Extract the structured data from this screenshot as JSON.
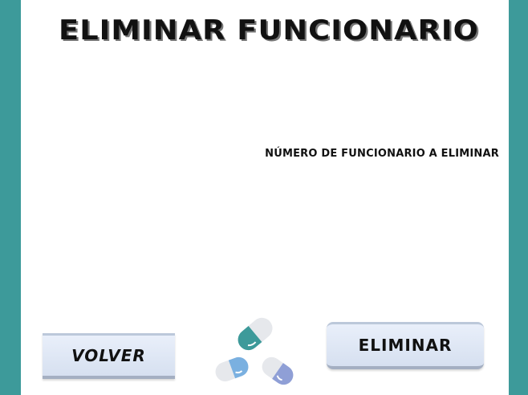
{
  "page": {
    "title": "ELIMINAR FUNCIONARIO",
    "field_label": "NÚMERO DE FUNCIONARIO A ELIMINAR"
  },
  "buttons": {
    "back_label": "VOLVER",
    "delete_label": "ELIMINAR"
  },
  "colors": {
    "frame": "#3d9a9a",
    "pill_teal": "#3d9a9a",
    "pill_blue": "#7ab0e0",
    "pill_purple": "#8f9fd6",
    "button_bg": "#e0e8f5"
  },
  "icons": {
    "logo": "pills-icon"
  }
}
